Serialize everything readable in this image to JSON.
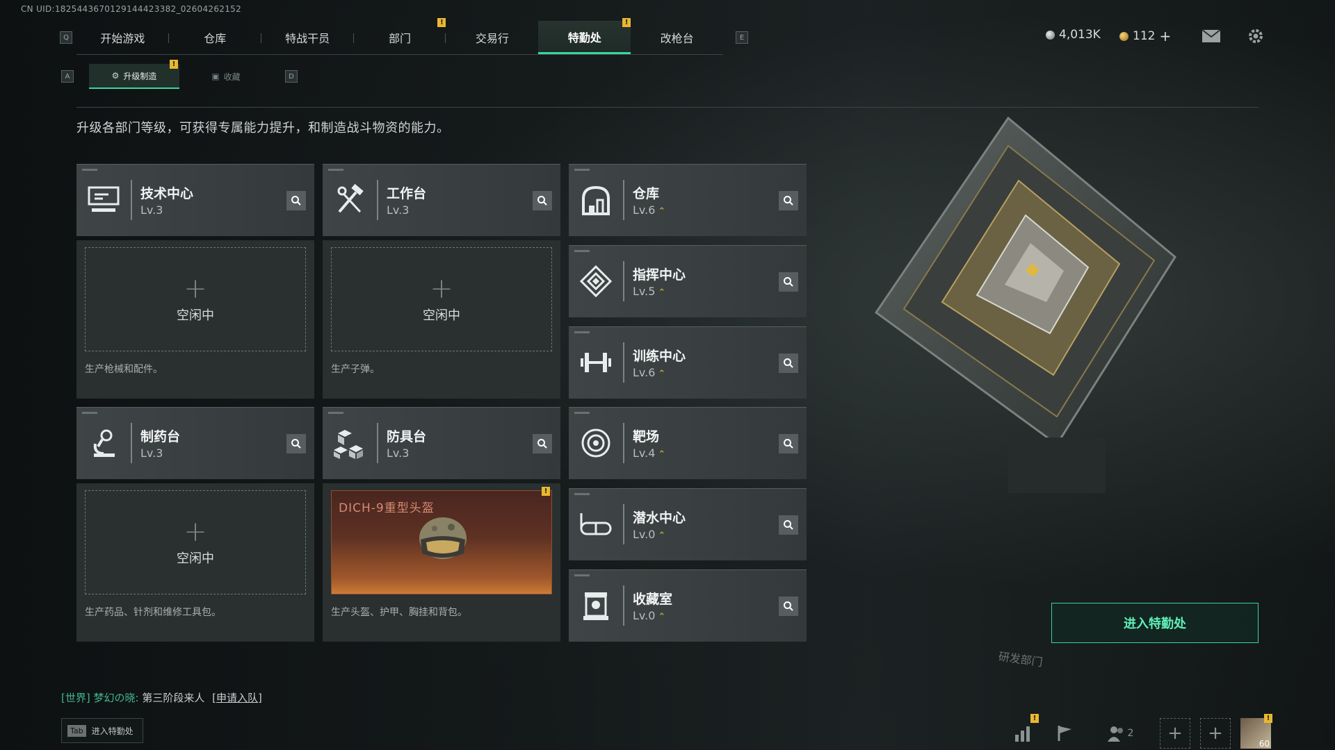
{
  "uid": "CN UID:1825443670129144423382_02604262152",
  "nav": {
    "left_key": "Q",
    "right_key": "E",
    "items": [
      {
        "label": "开始游戏",
        "badge": ""
      },
      {
        "label": "仓库",
        "badge": ""
      },
      {
        "label": "特战干员",
        "badge": ""
      },
      {
        "label": "部门",
        "badge": "!"
      },
      {
        "label": "交易行",
        "badge": ""
      },
      {
        "label": "特勤处",
        "badge": "!",
        "active": true
      },
      {
        "label": "改枪台",
        "badge": ""
      }
    ]
  },
  "currency": {
    "silver": "4,013K",
    "gold": "112",
    "plus": "+"
  },
  "subtabs": {
    "left_key": "A",
    "right_key": "D",
    "upgrade": "升级制造",
    "upgrade_badge": "!",
    "collect": "收藏"
  },
  "description": "升级各部门等级，可获得专属能力提升，和制造战斗物资的能力。",
  "workbenches": [
    {
      "name": "技术中心",
      "level": "Lv.3",
      "slot_plus": "+",
      "slot_status": "空闲中",
      "produces": "生产枪械和配件。"
    },
    {
      "name": "工作台",
      "level": "Lv.3",
      "slot_plus": "+",
      "slot_status": "空闲中",
      "produces": "生产子弹。"
    },
    {
      "name": "制药台",
      "level": "Lv.3",
      "slot_plus": "+",
      "slot_status": "空闲中",
      "produces": "生产药品、针剂和维修工具包。"
    },
    {
      "name": "防具台",
      "level": "Lv.3",
      "crafting": "DICH-9重型头盔",
      "crafting_badge": "!",
      "produces": "生产头盔、护甲、胸挂和背包。"
    }
  ],
  "facilities": [
    {
      "name": "仓库",
      "level": "Lv.6",
      "up": "⌃"
    },
    {
      "name": "指挥中心",
      "level": "Lv.5",
      "up": "⌃"
    },
    {
      "name": "训练中心",
      "level": "Lv.6",
      "up": "⌃"
    },
    {
      "name": "靶场",
      "level": "Lv.4",
      "up": "⌃"
    },
    {
      "name": "潜水中心",
      "level": "Lv.0",
      "up": "⌃"
    },
    {
      "name": "收藏室",
      "level": "Lv.0",
      "up": "⌃"
    }
  ],
  "enter_button": "进入特勤处",
  "bg_sign": "研发部门",
  "chat": {
    "channel": "[世界]",
    "sender": "梦幻の晓:",
    "message": "第三阶段来人",
    "link": "[申请入队]"
  },
  "tab_hint": {
    "key": "Tab",
    "label": "进入特勤处"
  },
  "bottom_bar": {
    "friends_count": "2",
    "avatar_level": "60",
    "badge": "!"
  },
  "colors": {
    "accent": "#3bd6a0",
    "badge": "#e8b830",
    "upgrade": "#e6b634"
  }
}
